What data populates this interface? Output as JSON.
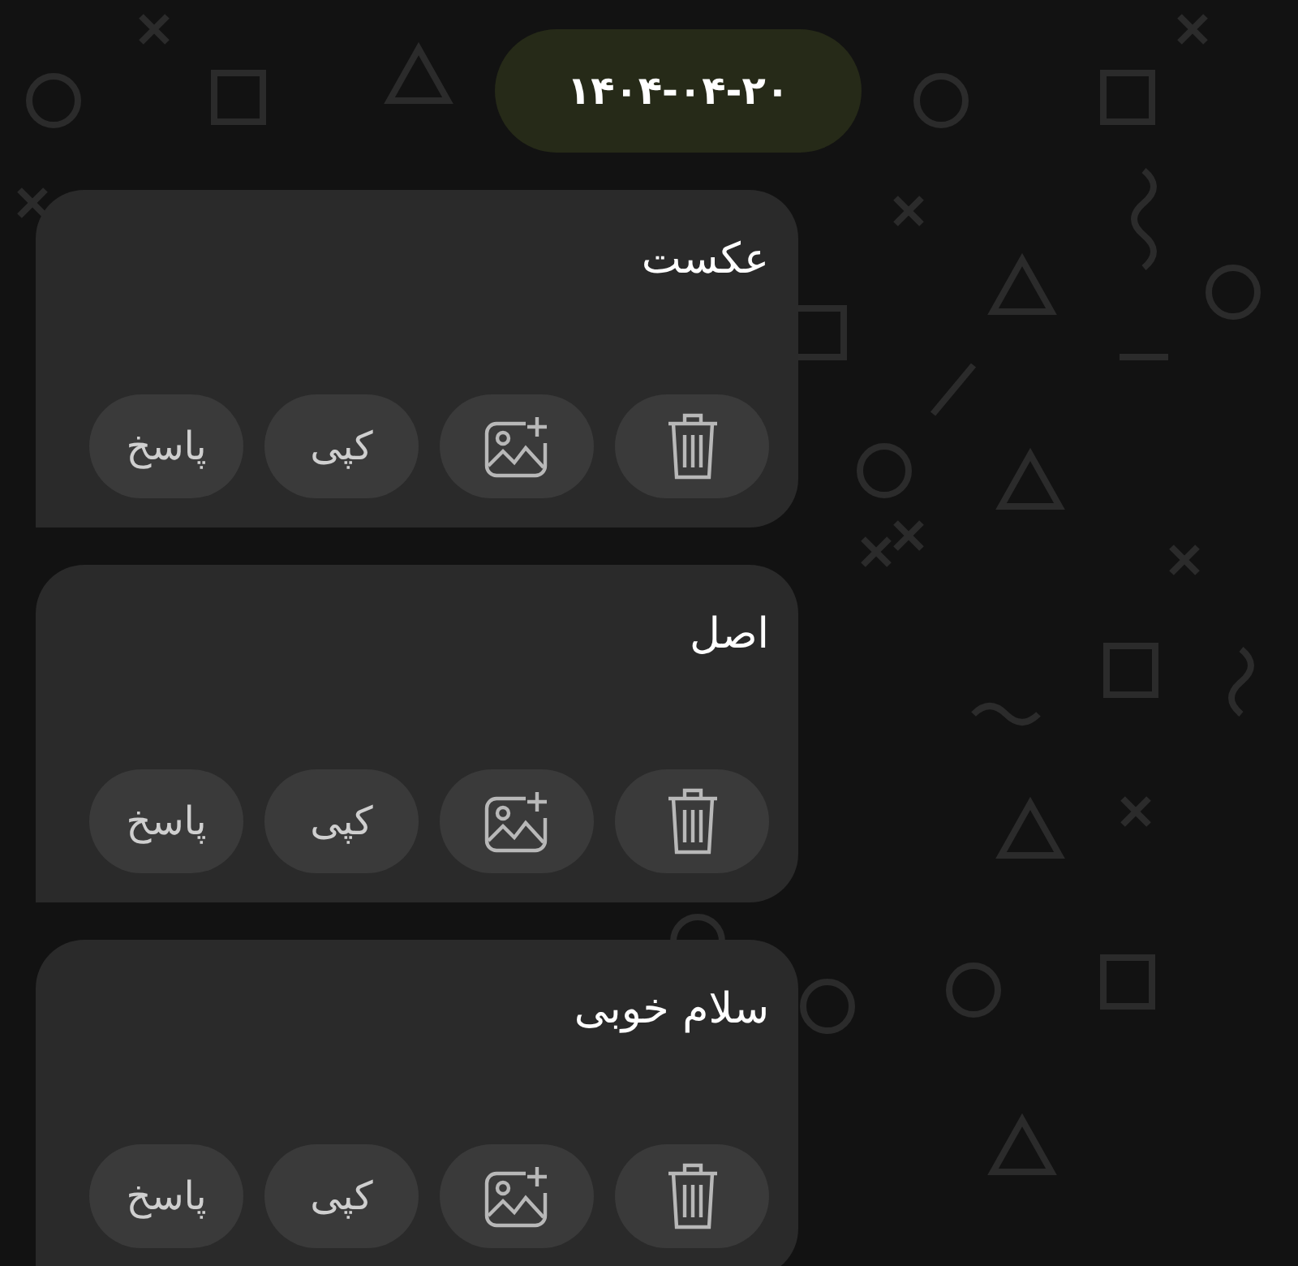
{
  "date_badge": "۱۴۰۴-۰۴-۲۰",
  "messages": [
    {
      "text": "عکست",
      "actions": [
        {
          "kind": "delete"
        },
        {
          "kind": "add-image"
        },
        {
          "kind": "copy",
          "label": "کپی"
        },
        {
          "kind": "reply",
          "label": "پاسخ"
        }
      ]
    },
    {
      "text": "اصل",
      "actions": [
        {
          "kind": "delete"
        },
        {
          "kind": "add-image"
        },
        {
          "kind": "copy",
          "label": "کپی"
        },
        {
          "kind": "reply",
          "label": "پاسخ"
        }
      ]
    },
    {
      "text": "سلام خوبی",
      "actions": [
        {
          "kind": "delete"
        },
        {
          "kind": "add-image"
        },
        {
          "kind": "copy",
          "label": "کپی"
        },
        {
          "kind": "reply",
          "label": "پاسخ"
        }
      ]
    }
  ]
}
